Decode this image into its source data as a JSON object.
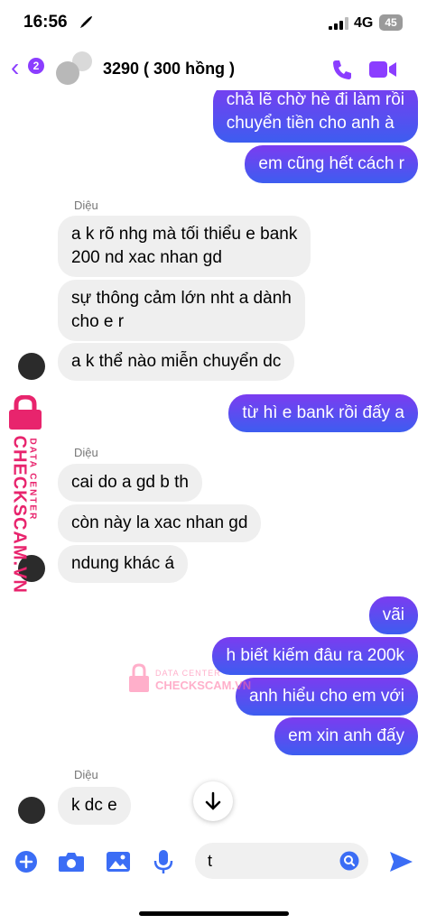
{
  "status": {
    "time": "16:56",
    "network": "4G",
    "battery": "45"
  },
  "header": {
    "back_count": "2",
    "title": "3290 ( 300 hồng )"
  },
  "messages": {
    "out1": "chả lẽ chờ hè đi làm rồi\nchuyển tiền cho anh à",
    "out2": "em cũng hết cách r",
    "sender1": "Diệu",
    "in1": "a k rõ nhg mà tối thiểu e bank\n200 nd xac nhan gd",
    "in2": "sự thông cảm lớn nht a dành\ncho e r",
    "in3": "a k thể nào miễn chuyển dc",
    "out3": "từ hì e bank rồi đấy a",
    "sender2": "Diệu",
    "in4": "cai do a gd b th",
    "in5": "còn này la xac nhan gd",
    "in6": "ndung khác á",
    "out4": "vãi",
    "out5": "h biết kiếm đâu ra 200k",
    "out6": "anh hiểu cho em với",
    "out7": "em xin anh đấy",
    "sender3": "Diệu",
    "in7": "k dc e"
  },
  "watermark": {
    "line1": "DATA CENTER",
    "line2": "CHECKSCAM.VN"
  },
  "composer": {
    "input_value": "t"
  },
  "colors": {
    "accent": "#8b3dff",
    "bubble_top": "#7b3cf0",
    "bubble_bottom": "#3d5df0",
    "composer_icon": "#3b6df5",
    "watermark": "#e8246d"
  }
}
